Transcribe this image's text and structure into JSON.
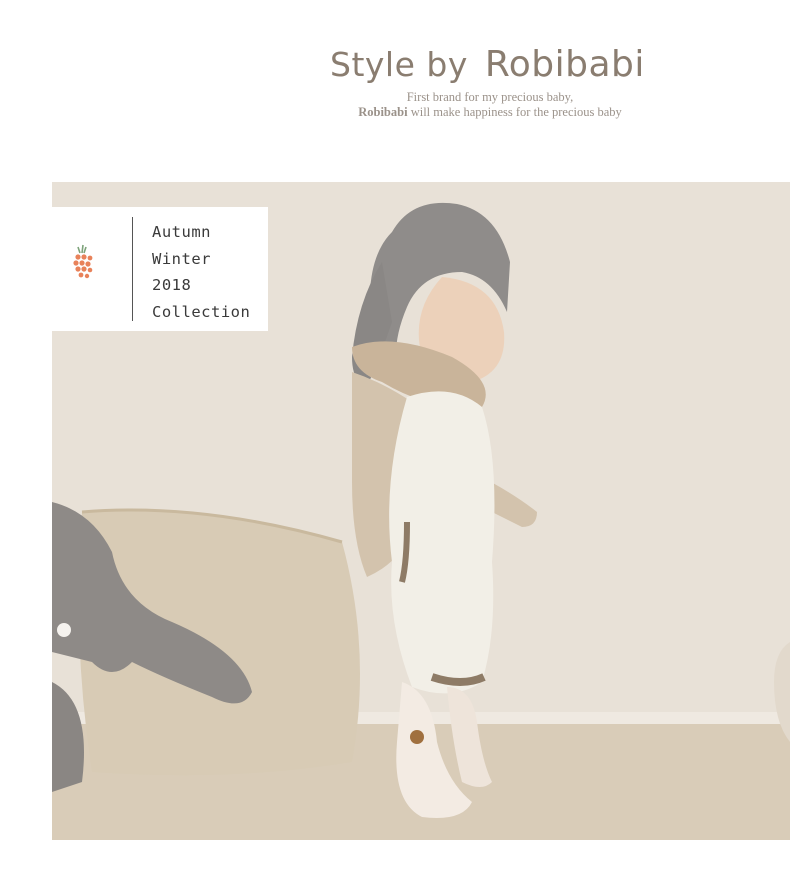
{
  "header": {
    "title_prefix": "Style by",
    "title_brand": "Robibabi",
    "tagline_line1": "First brand for my precious baby,",
    "tagline_brand": "Robibabi",
    "tagline_line2_rest": " will make happiness for the precious baby"
  },
  "collection_card": {
    "lines": [
      "Autumn",
      "Winter",
      "2018",
      "Collection"
    ],
    "logo_icon": "berry-logo-icon"
  },
  "photo": {
    "subject": "baby-photo"
  },
  "colors": {
    "title_color": "#8a7d70",
    "tagline_color": "#9b928a",
    "card_text_color": "#3a3a3a",
    "berry_color": "#e8825a"
  }
}
